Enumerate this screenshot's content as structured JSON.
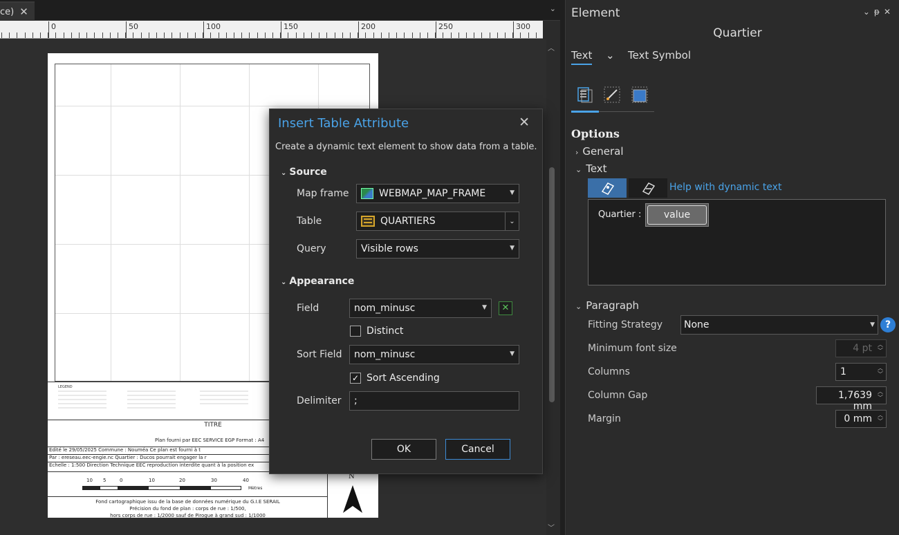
{
  "layout": {
    "tab_label": "ce)",
    "ruler_labels": [
      "0",
      "50",
      "100",
      "150",
      "200",
      "250",
      "300"
    ],
    "page": {
      "titre": "TITRE",
      "plan_line": "Plan fourni par EEC SERVICE EGP Format : A4",
      "meta_rows": [
        "Edité le 29/05/2025   Commune : Nouméa      Ce plan est fourni à t",
        "Par : ereseau.eec-engie.nc Quartier : Ducos   pourrait engager la r",
        "Echelle : 1:500     Direction Technique EEC reproduction interdite  quant à la position ex"
      ],
      "scale_numbers": [
        "10",
        "5",
        "0",
        "10",
        "20",
        "30",
        "40"
      ],
      "scale_unit": "Mètres",
      "fond_text": [
        "Fond cartographique issu de la base de données numérique du G.I.E SERAIL",
        "Précision du fond de plan : corps de rue : 1/500,",
        "hors corps de rue : 1/2000 sauf de Pirogue à grand sud : 1/1000"
      ],
      "north_label": "N",
      "legend_title": "LEGEND"
    }
  },
  "dialog": {
    "title": "Insert Table Attribute",
    "description": "Create a dynamic text element to show data from a table.",
    "source_header": "Source",
    "map_frame_label": "Map frame",
    "map_frame_value": "WEBMAP_MAP_FRAME",
    "table_label": "Table",
    "table_value": "QUARTIERS",
    "query_label": "Query",
    "query_value": "Visible rows",
    "appearance_header": "Appearance",
    "field_label": "Field",
    "field_value": "nom_minusc",
    "distinct_label": "Distinct",
    "distinct_checked": false,
    "sort_field_label": "Sort Field",
    "sort_field_value": "nom_minusc",
    "sort_ascending_label": "Sort Ascending",
    "sort_ascending_checked": true,
    "delimiter_label": "Delimiter",
    "delimiter_value": ";",
    "ok_label": "OK",
    "cancel_label": "Cancel"
  },
  "panel": {
    "title": "Element",
    "element_name": "Quartier",
    "tabs": [
      "Text",
      "Text Symbol"
    ],
    "options_header": "Options",
    "general_label": "General",
    "text_label": "Text",
    "help_link": "Help with dynamic text",
    "text_prefix": "Quartier :",
    "value_chip": "value",
    "paragraph_label": "Paragraph",
    "fitting_strategy_label": "Fitting Strategy",
    "fitting_strategy_value": "None",
    "min_font_label": "Minimum font size",
    "min_font_value": "4 pt",
    "columns_label": "Columns",
    "columns_value": "1",
    "column_gap_label": "Column Gap",
    "column_gap_value": "1,7639 mm",
    "margin_label": "Margin",
    "margin_value": "0 mm",
    "accent_color": "#4aa3e8"
  }
}
